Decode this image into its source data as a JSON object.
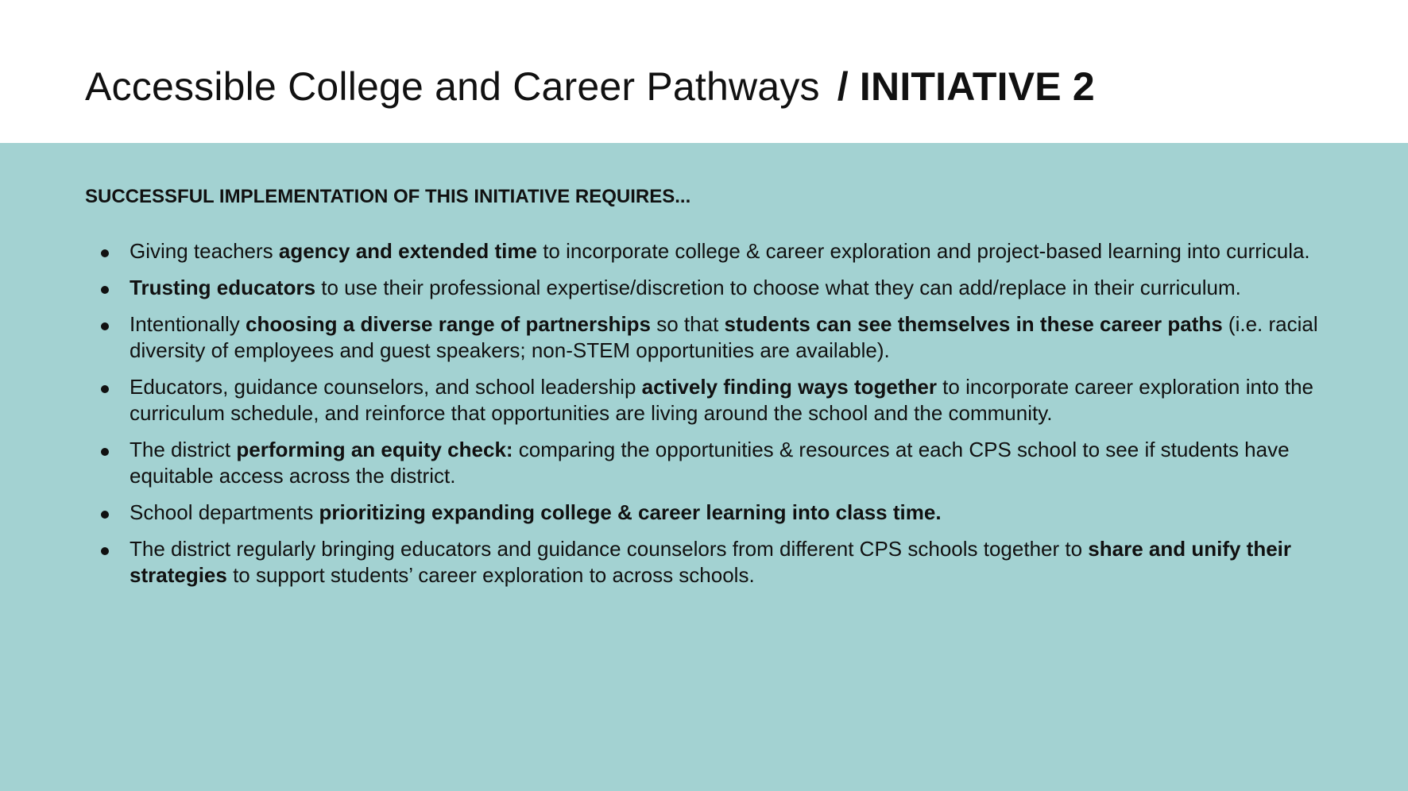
{
  "header": {
    "title_main": "Accessible College and Career Pathways",
    "title_suffix": "/ INITIATIVE 2"
  },
  "panel": {
    "heading": "SUCCESSFUL IMPLEMENTATION OF THIS INITIATIVE REQUIRES...",
    "items": [
      {
        "p0": "Giving teachers ",
        "b0": "agency and extended time",
        "p1": " to incorporate college & career exploration and project-based learning into curricula."
      },
      {
        "b0": "Trusting educators",
        "p1": " to use their professional expertise/discretion to choose what they can add/replace in their curriculum."
      },
      {
        "p0": "Intentionally ",
        "b0": "choosing a diverse range of partnerships",
        "p1": " so that ",
        "b1": "students can see themselves in these career paths",
        "p2": " (i.e. racial diversity of employees and guest speakers; non-STEM opportunities are available)."
      },
      {
        "p0": "Educators, guidance counselors, and school leadership ",
        "b0": "actively finding ways together",
        "p1": " to incorporate career exploration into the curriculum schedule, and reinforce that opportunities are living around the school and the community."
      },
      {
        "p0": "The district ",
        "b0": "performing an equity check:",
        "p1": " comparing the opportunities & resources at each CPS school to see if students have equitable access across the district."
      },
      {
        "p0": "School departments ",
        "b0": "prioritizing expanding college & career learning into class time."
      },
      {
        "p0": "The district regularly bringing educators and guidance counselors from different CPS schools together to ",
        "b0": "share and unify their strategies",
        "p1": " to support students’ career exploration to across schools."
      }
    ]
  }
}
